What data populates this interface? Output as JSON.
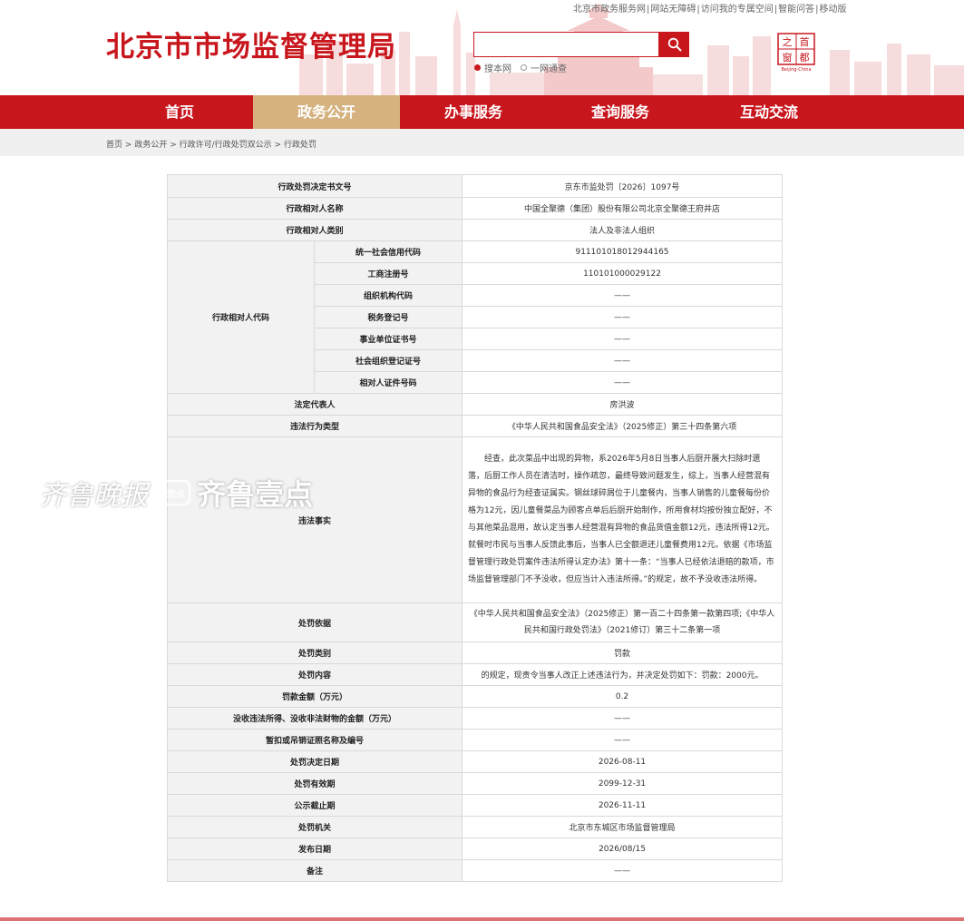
{
  "header": {
    "site_title": "北京市市场监督管理局",
    "top_links": [
      "北京市政务服务网",
      "网站无障碍",
      "访问我的专属空间",
      "智能问答",
      "移动版"
    ],
    "search": {
      "placeholder": "",
      "scopes": [
        "搜本网",
        "一网通查"
      ],
      "selected_scope": "搜本网"
    },
    "logo": {
      "chars": [
        "首",
        "都",
        "之",
        "窗"
      ],
      "subtitle": "Beijing-China"
    }
  },
  "nav": {
    "items": [
      "首页",
      "政务公开",
      "办事服务",
      "查询服务",
      "互动交流"
    ],
    "active": "政务公开"
  },
  "breadcrumb": [
    "首页",
    "政务公开",
    "行政许可/行政处罚双公示",
    "行政处罚"
  ],
  "breadcrumb_sep": ">",
  "record": {
    "doc_no_label": "行政处罚决定书文号",
    "doc_no": "京东市监处罚〔2026〕1097号",
    "party_name_label": "行政相对人名称",
    "party_name": "中国全聚德（集团）股份有限公司北京全聚德王府井店",
    "party_type_label": "行政相对人类别",
    "party_type": "法人及非法人组织",
    "party_code_label": "行政相对人代码",
    "codes": [
      {
        "label": "统一社会信用代码",
        "value": "911101018012944165"
      },
      {
        "label": "工商注册号",
        "value": "110101000029122"
      },
      {
        "label": "组织机构代码",
        "value": "——"
      },
      {
        "label": "税务登记号",
        "value": "——"
      },
      {
        "label": "事业单位证书号",
        "value": "——"
      },
      {
        "label": "社会组织登记证号",
        "value": "——"
      },
      {
        "label": "相对人证件号码",
        "value": "——"
      }
    ],
    "legal_rep_label": "法定代表人",
    "legal_rep": "房洪波",
    "violation_type_label": "违法行为类型",
    "violation_type": "《中华人民共和国食品安全法》（2025修正）第三十四条第六项",
    "facts_label": "违法事实",
    "facts": "经查，此次菜品中出现的异物，系2026年5月8日当事人后厨开展大扫除时遗落，后厨工作人员在清洁时，操作疏忽，最终导致问题发生，综上，当事人经营混有异物的食品行为经查证属实。钢丝球碎屑位于儿童餐内，当事人销售的儿童餐每份价格为12元，因儿童餐菜品为顾客点单后后厨开始制作，所用食材均按份独立配好，不与其他菜品混用，故认定当事人经营混有异物的食品货值金额12元，违法所得12元。就餐时市民与当事人反馈此事后，当事人已全额退还儿童餐费用12元。依据《市场监督管理行政处罚案件违法所得认定办法》第十一条：“当事人已经依法退赔的款项，市场监督管理部门不予没收，但应当计入违法所得。”的规定，故不予没收违法所得。",
    "basis_label": "处罚依据",
    "basis": "《中华人民共和国食品安全法》（2025修正）第一百二十四条第一款第四项;《中华人民共和国行政处罚法》（2021修订）第三十二条第一项",
    "penalty_type_label": "处罚类别",
    "penalty_type": "罚款",
    "penalty_content_label": "处罚内容",
    "penalty_content": "的规定，现责令当事人改正上述违法行为，并决定处罚如下：罚款：2000元。",
    "fine_label": "罚款金额（万元）",
    "fine": "0.2",
    "confiscation_label": "没收违法所得、没收非法财物的金额（万元）",
    "confiscation": "——",
    "license_label": "暂扣或吊销证照名称及编号",
    "license": "——",
    "decision_date_label": "处罚决定日期",
    "decision_date": "2026-08-11",
    "valid_until_label": "处罚有效期",
    "valid_until": "2099-12-31",
    "publicity_end_label": "公示截止期",
    "publicity_end": "2026-11-11",
    "authority_label": "处罚机关",
    "authority": "北京市东城区市场监督管理局",
    "publish_date_label": "发布日期",
    "publish_date": "2026/08/15",
    "remarks_label": "备注",
    "remarks": "——"
  },
  "watermark": {
    "text1": "齐鲁晚报",
    "badge": "壹点",
    "text2": "齐鲁壹点"
  },
  "colors": {
    "brand_red": "#c8161d",
    "nav_active": "#d5b27f",
    "label_bg": "#f2f2f2",
    "border": "#d9d9d9"
  }
}
